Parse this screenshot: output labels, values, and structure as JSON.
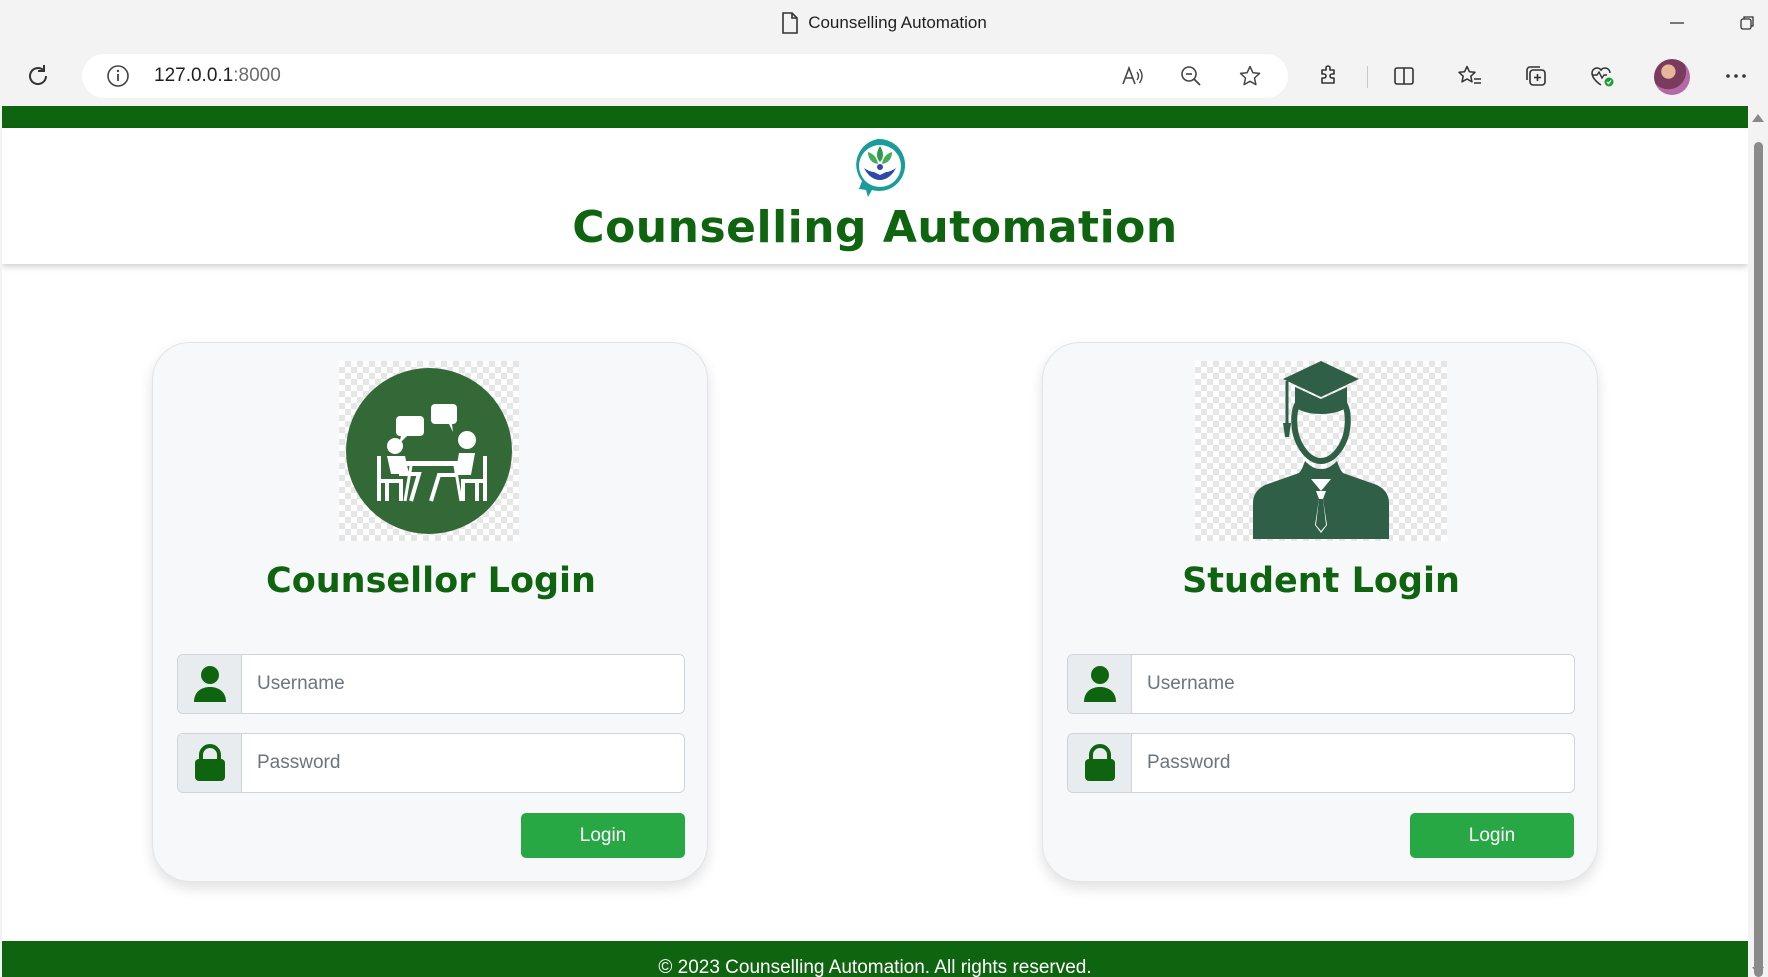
{
  "browser": {
    "tab_title": "Counselling Automation",
    "url_host": "127.0.0.1",
    "url_port": ":8000"
  },
  "site": {
    "title": "Counselling Automation",
    "brand_color": "#0f6410",
    "button_color": "#28a745"
  },
  "counsellor": {
    "heading": "Counsellor Login",
    "username_placeholder": "Username",
    "password_placeholder": "Password",
    "login_label": "Login"
  },
  "student": {
    "heading": "Student Login",
    "username_placeholder": "Username",
    "password_placeholder": "Password",
    "login_label": "Login"
  },
  "footer": {
    "text": "© 2023 Counselling Automation. All rights reserved."
  }
}
